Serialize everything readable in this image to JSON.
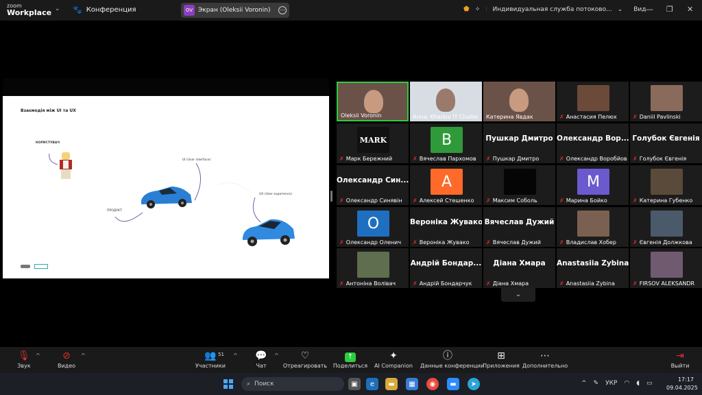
{
  "topbar": {
    "brand_small": "zoom",
    "brand_large": "Workplace",
    "meeting_label": "Конференция",
    "share_avatar": "OV",
    "share_title": "Экран (Oleksii Voronin)",
    "stream_name": "Индивидуальная служба потоково...",
    "view_label": "Вид"
  },
  "slide": {
    "title": "Взаємодія між UI та UX",
    "user_label": "КОРИСТУВАЧ",
    "ui_label": "UI (User interface)",
    "product_label": "ПРОДУКТ",
    "ux_label": "UX (User experience)"
  },
  "participants": [
    {
      "name": "Oleksii Voronin",
      "kind": "video",
      "active": true,
      "mic_off": false
    },
    {
      "name": "Anna, Kharkiv IT Cluster",
      "kind": "video",
      "active": false,
      "mic_off": false
    },
    {
      "name": "Катерина Явдак",
      "kind": "video",
      "active": false,
      "mic_off": false
    },
    {
      "name": "Анастасия Пелюх",
      "kind": "photo",
      "mic_off": true
    },
    {
      "name": "Daniil Pavlinski",
      "kind": "photo",
      "mic_off": true
    },
    {
      "name": "Марк Бережний",
      "kind": "avatar",
      "avatar": "MARK",
      "mic_off": true
    },
    {
      "name": "Вячеслав Пархомов",
      "kind": "avatar",
      "avatar": "B",
      "mic_off": true
    },
    {
      "name": "Пушкар Дмитро",
      "kind": "text",
      "display": "Пушкар Дмитро",
      "mic_off": true
    },
    {
      "name": "Олександр Воробйов",
      "kind": "text",
      "display": "Олександр Вор...",
      "mic_off": true
    },
    {
      "name": "Голубок Євгенія",
      "kind": "text",
      "display": "Голубок Євгенія",
      "mic_off": true
    },
    {
      "name": "Олександр Синявін",
      "kind": "text",
      "display": "Олександр Син...",
      "mic_off": true
    },
    {
      "name": "Алексей Стешенко",
      "kind": "avatar",
      "avatar": "A",
      "mic_off": true
    },
    {
      "name": "Максим Соболь",
      "kind": "avatar",
      "avatar": "",
      "mic_off": true
    },
    {
      "name": "Марина Бойко",
      "kind": "avatar",
      "avatar": "M",
      "mic_off": true
    },
    {
      "name": "Катерина Губенко",
      "kind": "photo",
      "mic_off": true
    },
    {
      "name": "Олександр Оленич",
      "kind": "avatar",
      "avatar": "O",
      "mic_off": true
    },
    {
      "name": "Вероніка Жувако",
      "kind": "text",
      "display": "Вероніка Жувако",
      "mic_off": true
    },
    {
      "name": "Вячеслав Дужий",
      "kind": "text",
      "display": "Вячеслав Дужий",
      "mic_off": true
    },
    {
      "name": "Владислав Хобер",
      "kind": "photo",
      "mic_off": true
    },
    {
      "name": "Євгенія Должкова",
      "kind": "photo",
      "mic_off": true
    },
    {
      "name": "Антоніна Волівач",
      "kind": "photo",
      "mic_off": true
    },
    {
      "name": "Андрій Бондарчук",
      "kind": "text",
      "display": "Андрій Бондар...",
      "mic_off": true
    },
    {
      "name": "Діана Хмара",
      "kind": "text",
      "display": "Діана Хмара",
      "mic_off": true
    },
    {
      "name": "Anastasiia Zybina",
      "kind": "text",
      "display": "Anastasiia Zybina",
      "mic_off": true
    },
    {
      "name": "FIRSOV ALEKSANDR",
      "kind": "photo",
      "mic_off": true
    }
  ],
  "toolbar": {
    "audio": "Звук",
    "video": "Видео",
    "participants": "Участники",
    "participants_count": "51",
    "chat": "Чат",
    "react": "Отреагировать",
    "share": "Поделиться",
    "ai": "AI Companion",
    "info": "Данные конференции",
    "apps": "Приложения",
    "more": "Дополнительно",
    "leave": "Выйти"
  },
  "taskbar": {
    "search_placeholder": "Поиск",
    "lang": "УКР",
    "time": "17:17",
    "date": "09.04.2025"
  },
  "colors": {
    "accent_green": "#2ecc40",
    "muted_red": "#e03030",
    "avatar_green": "#2f9a3a",
    "avatar_orange": "#ff6a2b",
    "avatar_purple": "#6a5acd",
    "avatar_blue": "#1f6fc0"
  }
}
